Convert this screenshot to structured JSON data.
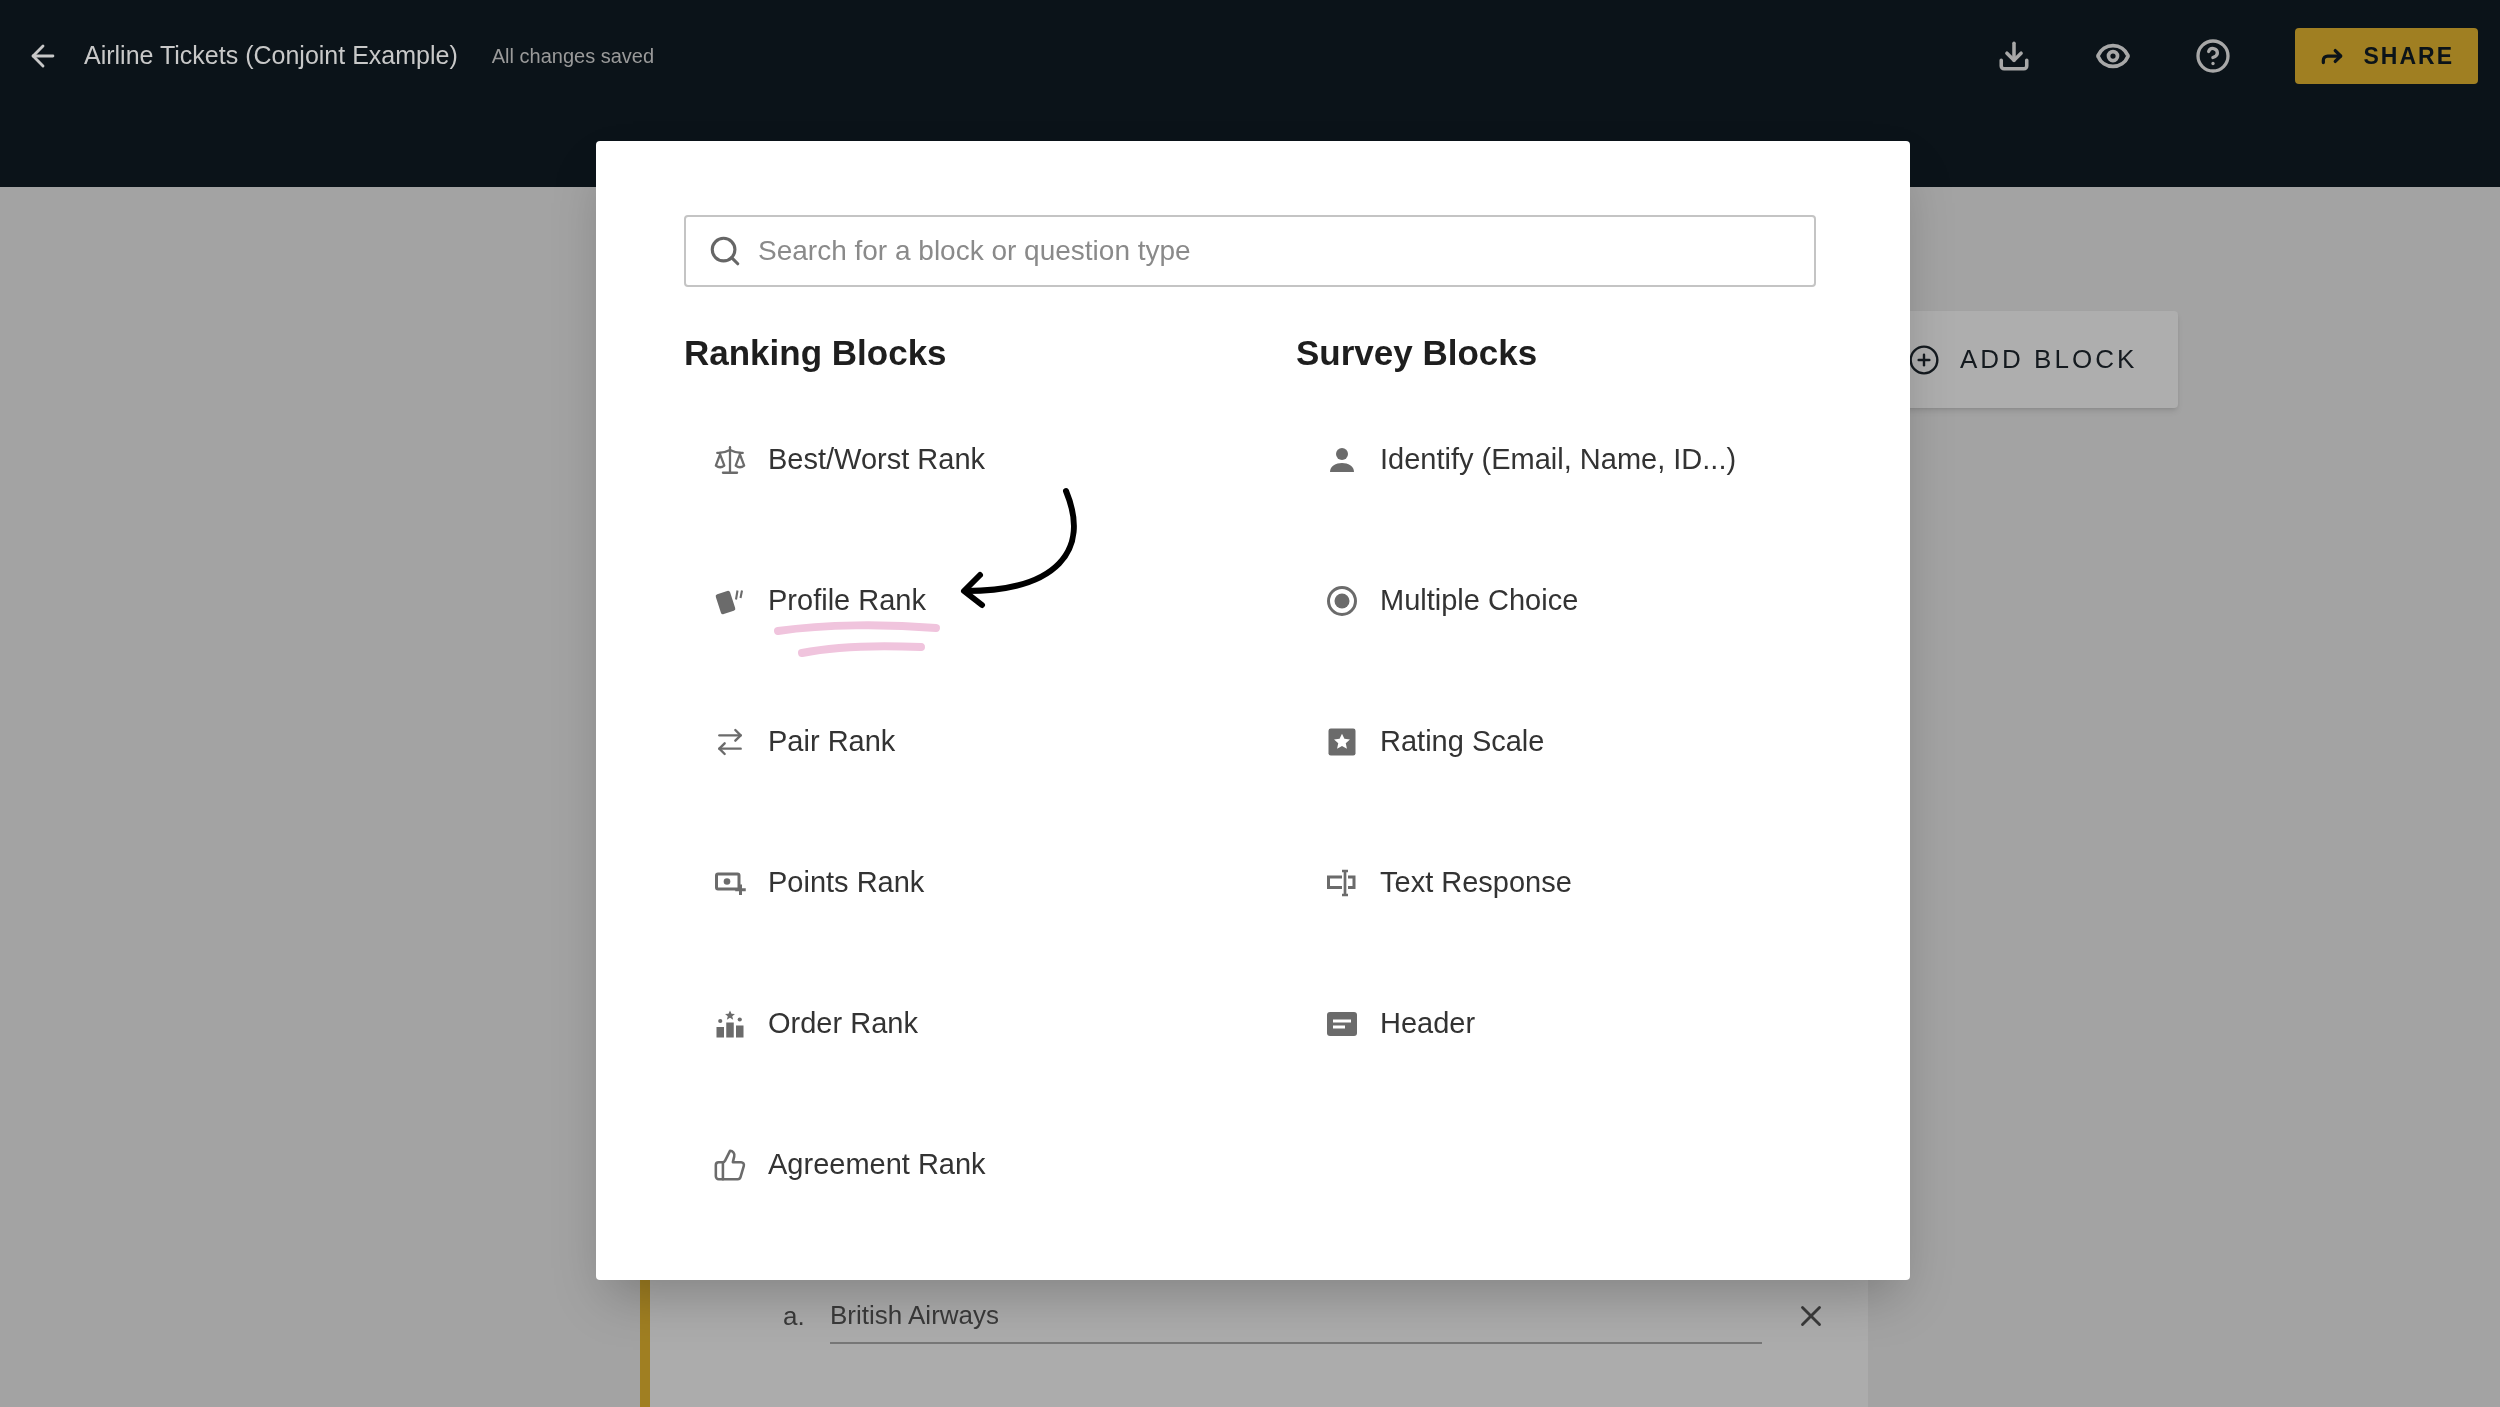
{
  "header": {
    "title": "Airline Tickets (Conjoint Example)",
    "save_status": "All changes saved",
    "share_label": "SHARE"
  },
  "page": {
    "add_block_label": "ADD BLOCK",
    "choices": [
      {
        "marker": "a.",
        "text": "British Airways"
      }
    ]
  },
  "modal": {
    "search": {
      "placeholder": "Search for a block or question type"
    },
    "columns": [
      {
        "heading": "Ranking Blocks",
        "items": [
          {
            "label": "Best/Worst Rank"
          },
          {
            "label": "Profile Rank"
          },
          {
            "label": "Pair Rank"
          },
          {
            "label": "Points Rank"
          },
          {
            "label": "Order Rank"
          },
          {
            "label": "Agreement Rank"
          }
        ]
      },
      {
        "heading": "Survey Blocks",
        "items": [
          {
            "label": "Identify (Email, Name, ID...)"
          },
          {
            "label": "Multiple Choice"
          },
          {
            "label": "Rating Scale"
          },
          {
            "label": "Text Response"
          },
          {
            "label": "Header"
          }
        ]
      }
    ]
  }
}
